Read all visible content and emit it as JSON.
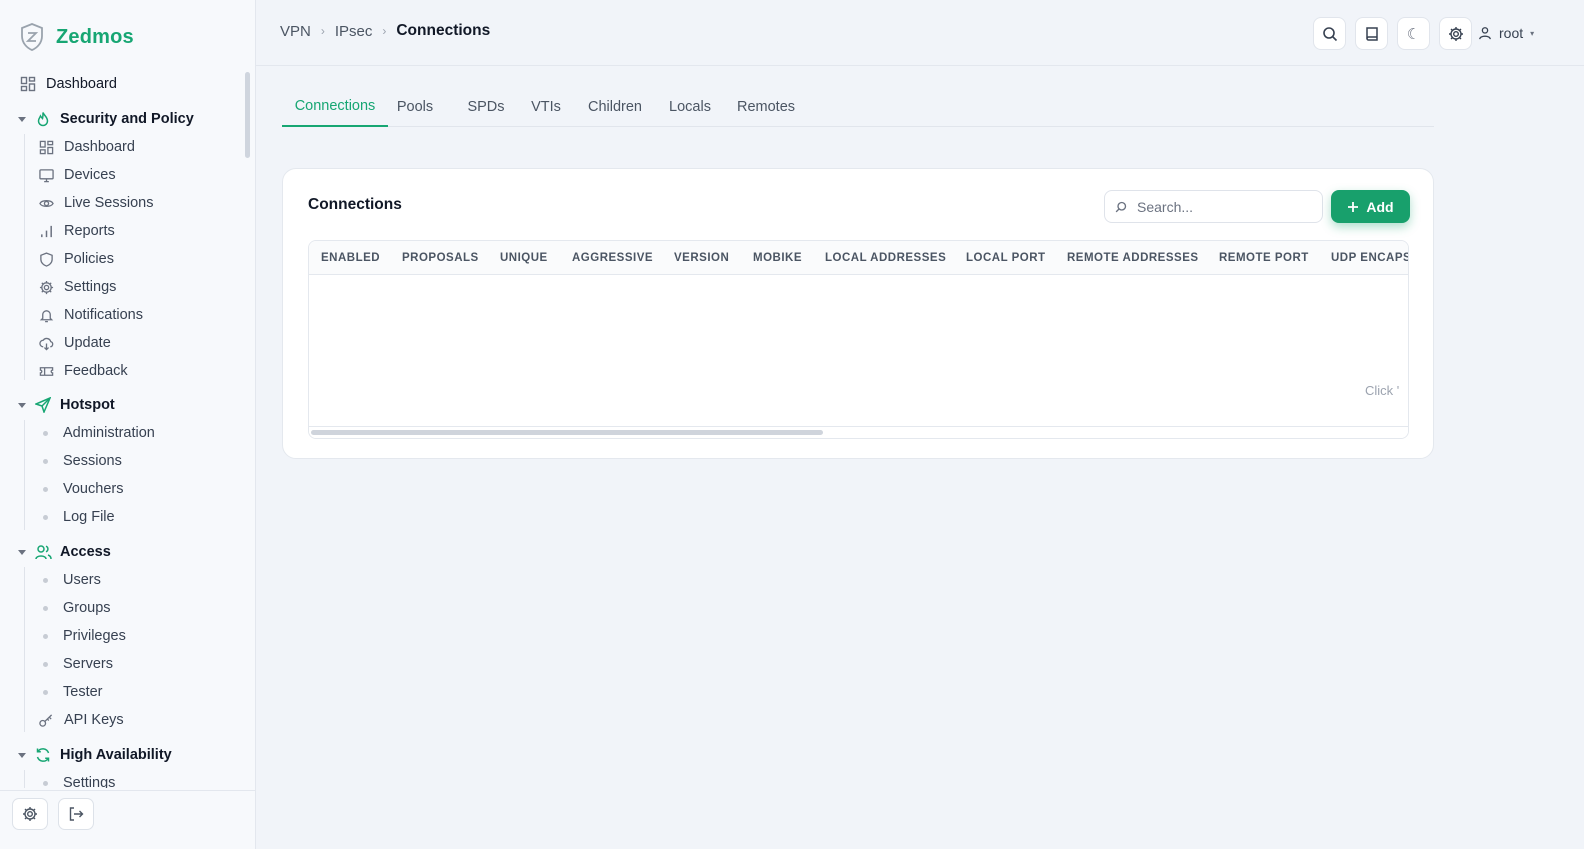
{
  "brand": {
    "name": "Zedmos",
    "accent": "#17a673"
  },
  "sidebar": {
    "top_item": {
      "label": "Dashboard",
      "icon": "grid-icon"
    },
    "groups": [
      {
        "title": "Security and Policy",
        "icon": "flame-icon",
        "items": [
          {
            "label": "Dashboard",
            "icon": "grid-icon"
          },
          {
            "label": "Devices",
            "icon": "monitor-icon"
          },
          {
            "label": "Live Sessions",
            "icon": "eye-icon"
          },
          {
            "label": "Reports",
            "icon": "bar-chart-icon"
          },
          {
            "label": "Policies",
            "icon": "shield-icon"
          },
          {
            "label": "Settings",
            "icon": "gear-icon"
          },
          {
            "label": "Notifications",
            "icon": "bell-icon"
          },
          {
            "label": "Update",
            "icon": "cloud-download-icon"
          },
          {
            "label": "Feedback",
            "icon": "ticket-icon"
          }
        ]
      },
      {
        "title": "Hotspot",
        "icon": "send-icon",
        "items": [
          {
            "label": "Administration"
          },
          {
            "label": "Sessions"
          },
          {
            "label": "Vouchers"
          },
          {
            "label": "Log File"
          }
        ]
      },
      {
        "title": "Access",
        "icon": "users-icon",
        "items": [
          {
            "label": "Users"
          },
          {
            "label": "Groups"
          },
          {
            "label": "Privileges"
          },
          {
            "label": "Servers"
          },
          {
            "label": "Tester"
          },
          {
            "label": "API Keys",
            "icon": "key-icon"
          }
        ]
      },
      {
        "title": "High Availability",
        "icon": "refresh-icon",
        "items": [
          {
            "label": "Settings"
          }
        ]
      }
    ]
  },
  "header": {
    "breadcrumb": [
      "VPN",
      "IPsec"
    ],
    "current": "Connections",
    "user": "root"
  },
  "tabs": [
    "Connections",
    "Pools",
    "SPDs",
    "VTIs",
    "Children",
    "Locals",
    "Remotes"
  ],
  "card": {
    "title": "Connections",
    "search_placeholder": "Search...",
    "add_label": "Add",
    "columns": [
      "ENABLED",
      "PROPOSALS",
      "UNIQUE",
      "AGGRESSIVE",
      "VERSION",
      "MOBIKE",
      "LOCAL ADDRESSES",
      "LOCAL PORT",
      "REMOTE ADDRESSES",
      "REMOTE PORT",
      "UDP ENCAPS"
    ],
    "empty_hint": "Click '"
  }
}
